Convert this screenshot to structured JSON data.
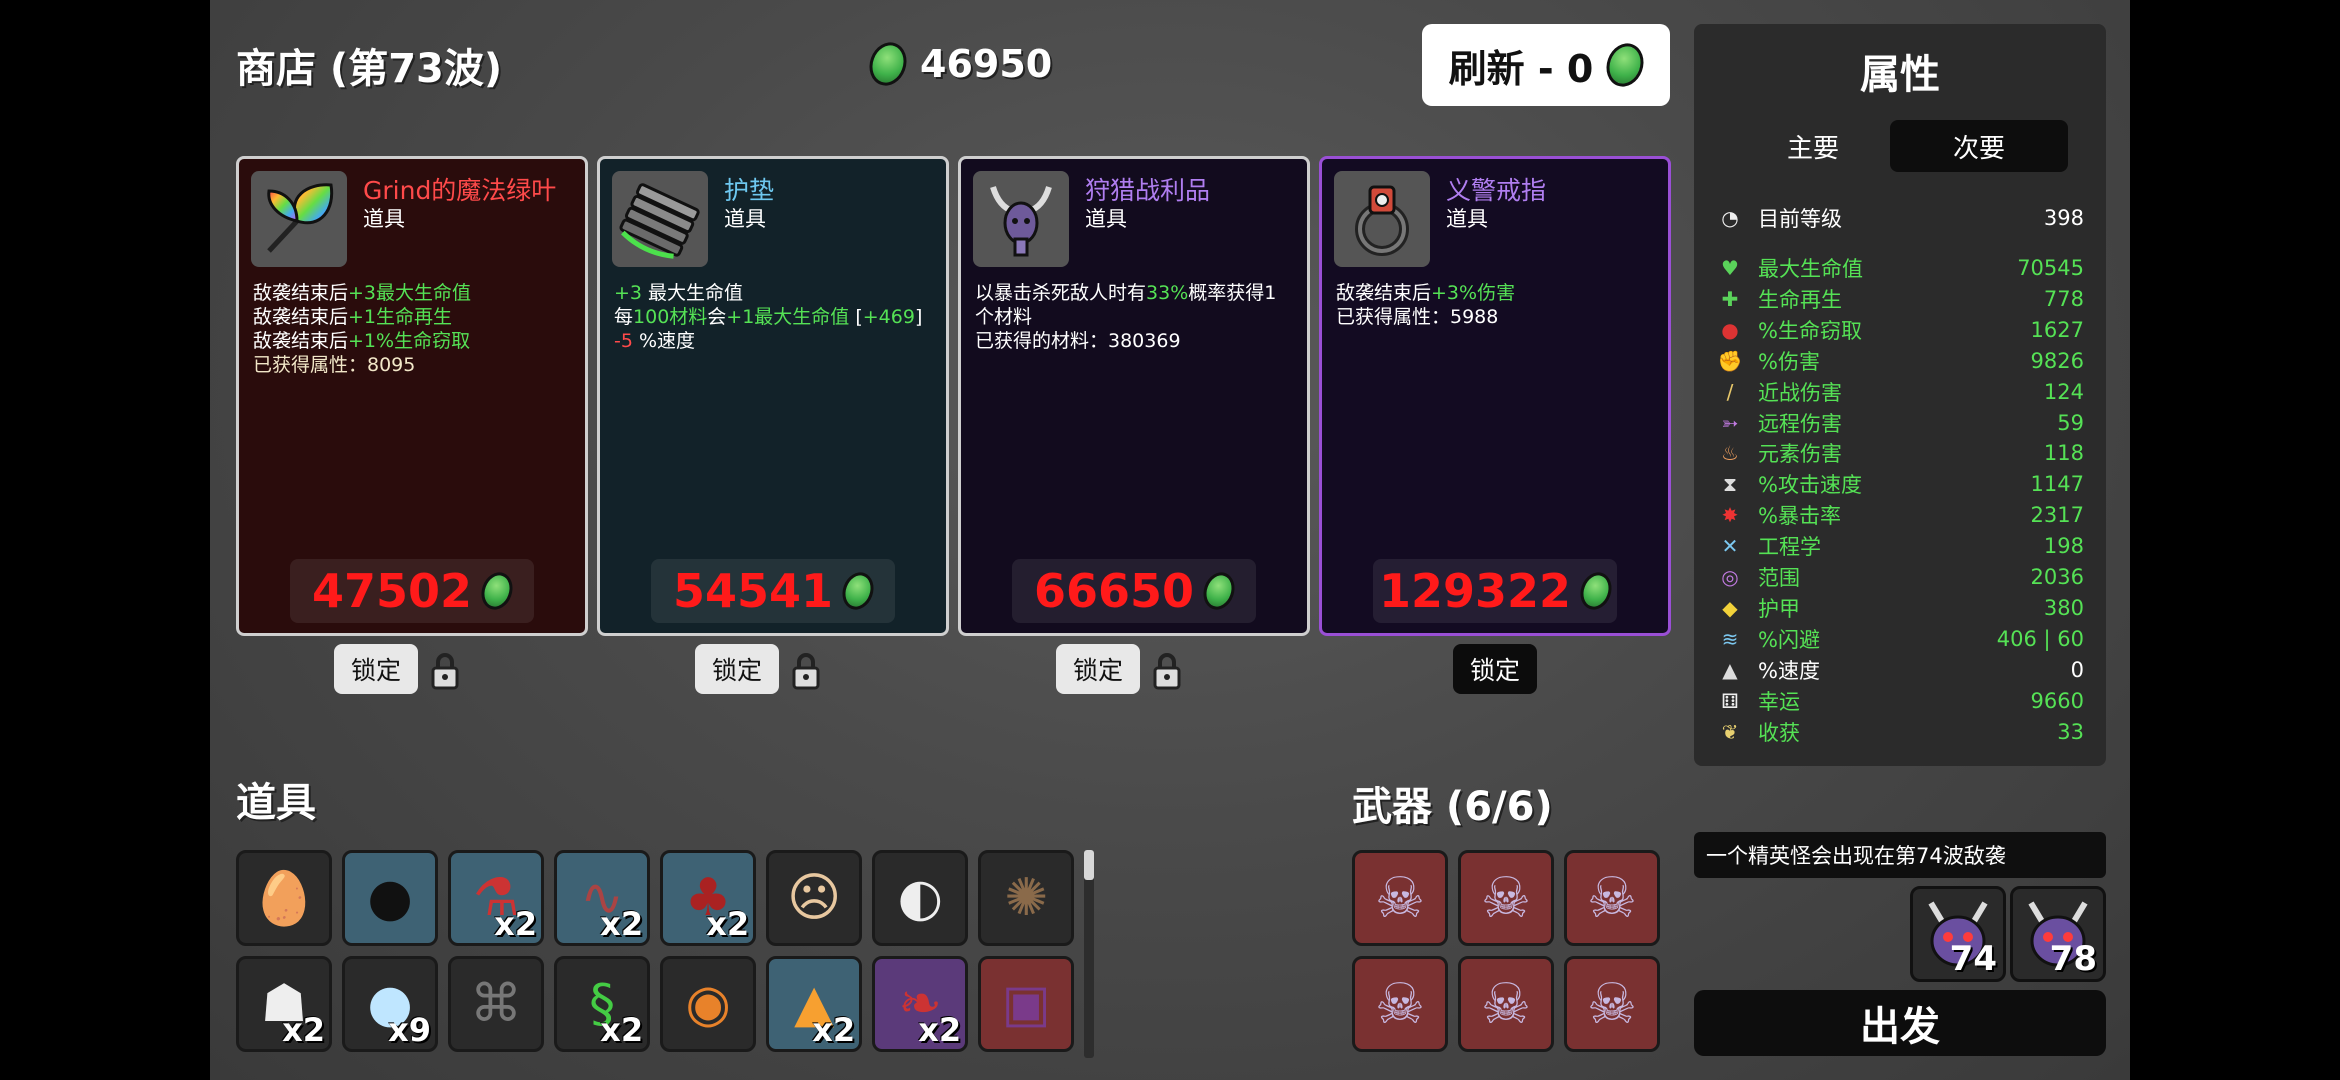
{
  "header": {
    "shop_title": "商店 (第73波)",
    "gold": "46950",
    "refresh_label": "刷新 - 0"
  },
  "shop_items": [
    {
      "name": "Grind的魔法绿叶",
      "type": "道具",
      "name_color": "#ff4a4a",
      "desc_lines": [
        {
          "pre": "敌袭结束后",
          "hl": "+3最大生命值",
          "post": ""
        },
        {
          "pre": "敌袭结束后",
          "hl": "+1生命再生",
          "post": ""
        },
        {
          "pre": "敌袭结束后",
          "hl": "+1%生命窃取",
          "post": ""
        }
      ],
      "extra": "已获得属性：8095",
      "price": "47502",
      "lock_label": "锁定",
      "locked": false
    },
    {
      "name": "护垫",
      "type": "道具",
      "name_color": "#6ec8f0",
      "desc_a": "+3",
      "desc_a2": " 最大生命值",
      "desc_b_pre": "每",
      "desc_b_hl1": "100材料",
      "desc_b_mid": "会",
      "desc_b_hl2": "+1最大生命值",
      "desc_b_post": " [",
      "desc_b_hl3": "+469",
      "desc_b_end": "]",
      "desc_c_hl": "-5",
      "desc_c_post": " %速度",
      "price": "54541",
      "lock_label": "锁定",
      "locked": false
    },
    {
      "name": "狩猎战利品",
      "type": "道具",
      "name_color": "#b07ef0",
      "desc_pre": "以暴击杀死敌人时有",
      "desc_hl": "33%",
      "desc_post": "概率获得1个材料",
      "extra": "已获得的材料：380369",
      "price": "66650",
      "lock_label": "锁定",
      "locked": false
    },
    {
      "name": "义警戒指",
      "type": "道具",
      "name_color": "#b07ef0",
      "desc_pre": "敌袭结束后",
      "desc_hl": "+3%伤害",
      "extra": "已获得属性：5988",
      "price": "129322",
      "lock_label": "锁定",
      "locked": true
    }
  ],
  "stats": {
    "title": "属性",
    "tab_primary": "主要",
    "tab_secondary": "次要",
    "level_label": "目前等级",
    "level_value": "398",
    "rows": [
      {
        "icon": "heart-icon",
        "name": "最大生命值",
        "value": "70545",
        "color": "green"
      },
      {
        "icon": "regen-icon",
        "name": "生命再生",
        "value": "778",
        "color": "green"
      },
      {
        "icon": "lifesteal-icon",
        "name": "%生命窃取",
        "value": "1627",
        "color": "green"
      },
      {
        "icon": "damage-icon",
        "name": "%伤害",
        "value": "9826",
        "color": "green"
      },
      {
        "icon": "melee-icon",
        "name": "近战伤害",
        "value": "124",
        "color": "green"
      },
      {
        "icon": "ranged-icon",
        "name": "远程伤害",
        "value": "59",
        "color": "green"
      },
      {
        "icon": "elemental-icon",
        "name": "元素伤害",
        "value": "118",
        "color": "green"
      },
      {
        "icon": "attack-speed-icon",
        "name": "%攻击速度",
        "value": "1147",
        "color": "green"
      },
      {
        "icon": "crit-icon",
        "name": "%暴击率",
        "value": "2317",
        "color": "green"
      },
      {
        "icon": "engineering-icon",
        "name": "工程学",
        "value": "198",
        "color": "green"
      },
      {
        "icon": "range-icon",
        "name": "范围",
        "value": "2036",
        "color": "green"
      },
      {
        "icon": "armor-icon",
        "name": "护甲",
        "value": "380",
        "color": "green"
      },
      {
        "icon": "dodge-icon",
        "name": "%闪避",
        "value": "406 | 60",
        "color": "green"
      },
      {
        "icon": "speed-icon",
        "name": "%速度",
        "value": "0",
        "color": "white"
      },
      {
        "icon": "luck-icon",
        "name": "幸运",
        "value": "9660",
        "color": "green"
      },
      {
        "icon": "harvest-icon",
        "name": "收获",
        "value": "33",
        "color": "green"
      }
    ]
  },
  "items_section": {
    "title": "道具",
    "slots": [
      {
        "icon": "egg-ghost-icon",
        "count": "",
        "bg": "dark"
      },
      {
        "icon": "bombs-icon",
        "count": "",
        "bg": "blue"
      },
      {
        "icon": "potion-icon",
        "count": "x2",
        "bg": "blue"
      },
      {
        "icon": "tentacle-icon",
        "count": "x2",
        "bg": "blue"
      },
      {
        "icon": "cherry-icon",
        "count": "x2",
        "bg": "blue"
      },
      {
        "icon": "face-icon",
        "count": "",
        "bg": "dark"
      },
      {
        "icon": "tooth-icon",
        "count": "",
        "bg": "dark"
      },
      {
        "icon": "hedgehog-icon",
        "count": "",
        "bg": "dark"
      },
      {
        "icon": "ghost-icon",
        "count": "x2",
        "bg": "dark"
      },
      {
        "icon": "snowball-icon",
        "count": "x9",
        "bg": "dark"
      },
      {
        "icon": "bat-icon",
        "count": "",
        "bg": "dark"
      },
      {
        "icon": "snake-icon",
        "count": "x2",
        "bg": "dark"
      },
      {
        "icon": "pumpkin-icon",
        "count": "",
        "bg": "dark"
      },
      {
        "icon": "campfire-icon",
        "count": "x2",
        "bg": "blue"
      },
      {
        "icon": "leaf-icon",
        "count": "x2",
        "bg": "purple"
      },
      {
        "icon": "chest-icon",
        "count": "",
        "bg": "red"
      }
    ]
  },
  "weapons_section": {
    "title": "武器 (6/6)",
    "slots": [
      "skull-wrench-icon",
      "skull-wrench-icon",
      "skull-wrench-icon",
      "skull-wrench-icon",
      "skull-wrench-icon",
      "skull-wrench-icon"
    ]
  },
  "next_wave": {
    "notice": "一个精英怪会出现在第74波敌袭",
    "enemies": [
      {
        "icon": "horned-demon-icon",
        "count": "74"
      },
      {
        "icon": "horned-demon-icon",
        "count": "78"
      }
    ],
    "go_label": "出发"
  },
  "colors": {
    "price_red": "#ff1a1a",
    "stat_green": "#55e255",
    "coin_green": "#3fb24a",
    "legendary_purple": "#9a4fd6"
  }
}
